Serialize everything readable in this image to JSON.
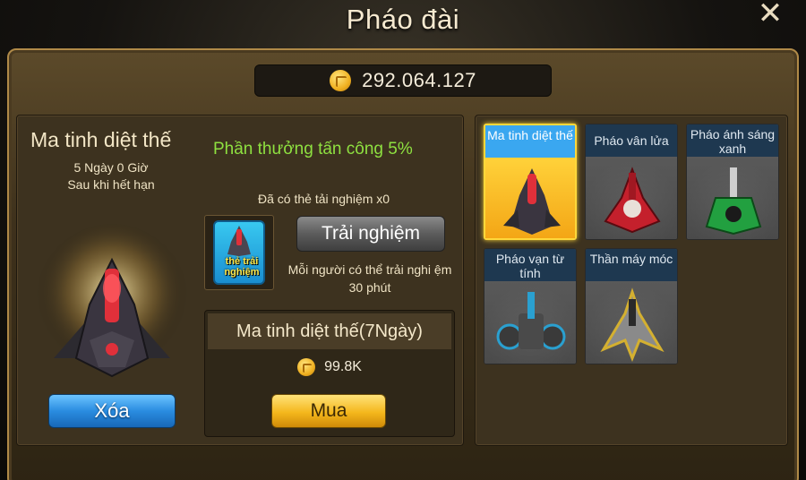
{
  "header": {
    "title": "Pháo đài",
    "close_symbol": "✕"
  },
  "currency": {
    "amount": "292.064.127",
    "icon": "gold-coin-icon"
  },
  "selected_turret": {
    "name": "Ma tinh diệt thế",
    "time_left": "5 Ngày 0 Giờ",
    "expire_note": "Sau khi hết hạn",
    "delete_label": "Xóa"
  },
  "bonus": {
    "reward_text": "Phần thưởng tấn công 5%"
  },
  "trial": {
    "owned_text": "Đã có thẻ tải nghiệm x0",
    "card_label": "thẻ trải nghiệm",
    "button_label": "Trải nghiệm",
    "note": "Mỗi người có thể trải nghi ệm 30 phút"
  },
  "purchase": {
    "item_label": "Ma tinh diệt thế(7Ngày)",
    "price": "99.8K",
    "buy_label": "Mua"
  },
  "turrets": [
    {
      "name": "Ma tinh diệt thế",
      "selected": true,
      "color": "#c0202a"
    },
    {
      "name": "Pháo vân lửa",
      "selected": false,
      "color": "#c4202c"
    },
    {
      "name": "Pháo ánh sáng xanh",
      "selected": false,
      "color": "#22a040"
    },
    {
      "name": "Pháo vạn từ tính",
      "selected": false,
      "color": "#2aa0d0"
    },
    {
      "name": "Thần máy móc",
      "selected": false,
      "color": "#d4b030"
    }
  ]
}
